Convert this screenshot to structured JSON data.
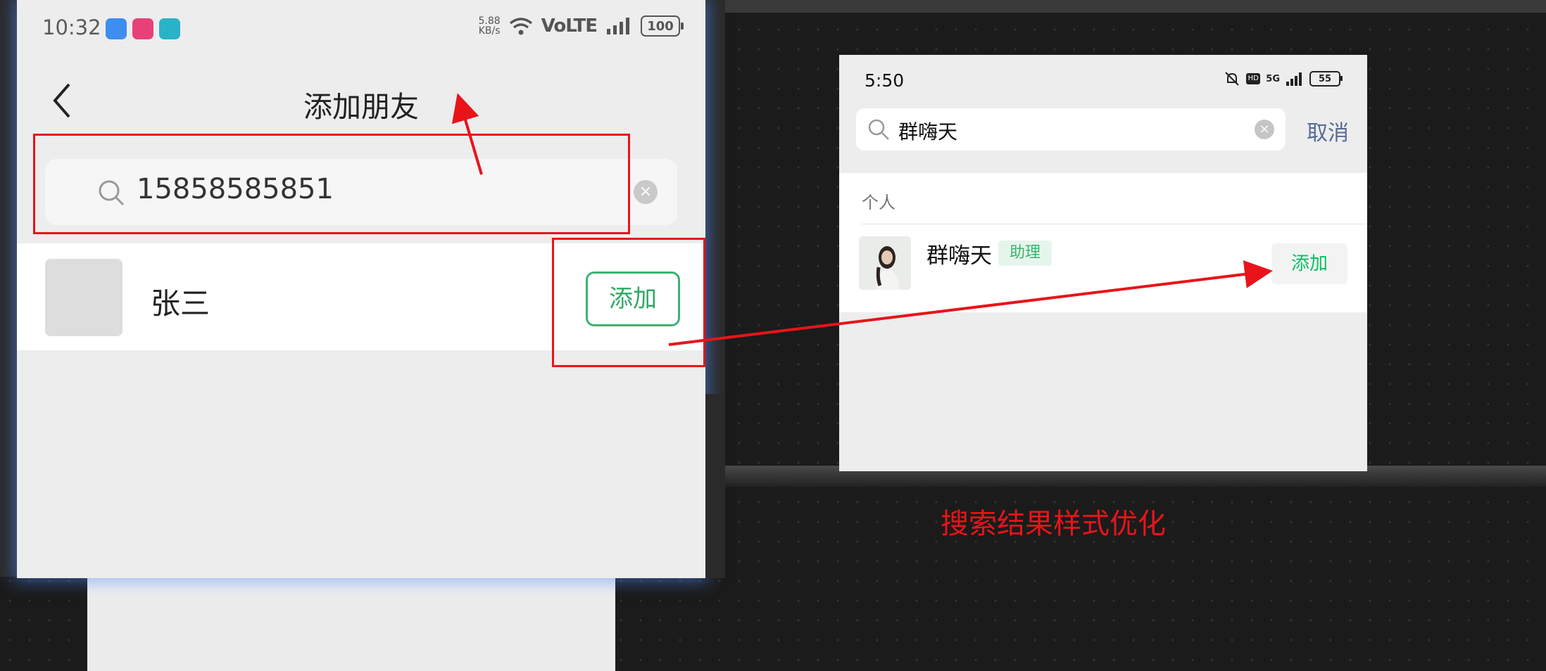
{
  "left_phone": {
    "status": {
      "time": "10:32",
      "speed": "5.88\nKB/s",
      "network": "VoLTE",
      "battery": "100"
    },
    "title": "添加朋友",
    "search": {
      "value": "15858585851"
    },
    "result": {
      "name": "张三",
      "add_label": "添加"
    }
  },
  "right_phone": {
    "status": {
      "time": "5:50",
      "net_label": "5G",
      "battery": "55"
    },
    "search": {
      "value": "群嗨天",
      "cancel_label": "取消"
    },
    "section_label": "个人",
    "result": {
      "name": "群嗨天",
      "badge": "助理",
      "add_label": "添加"
    }
  },
  "annotation": {
    "note": "搜索结果样式优化",
    "color": "#e8141a"
  },
  "colors": {
    "accent_green": "#07c160",
    "link_blue": "#576b95"
  }
}
